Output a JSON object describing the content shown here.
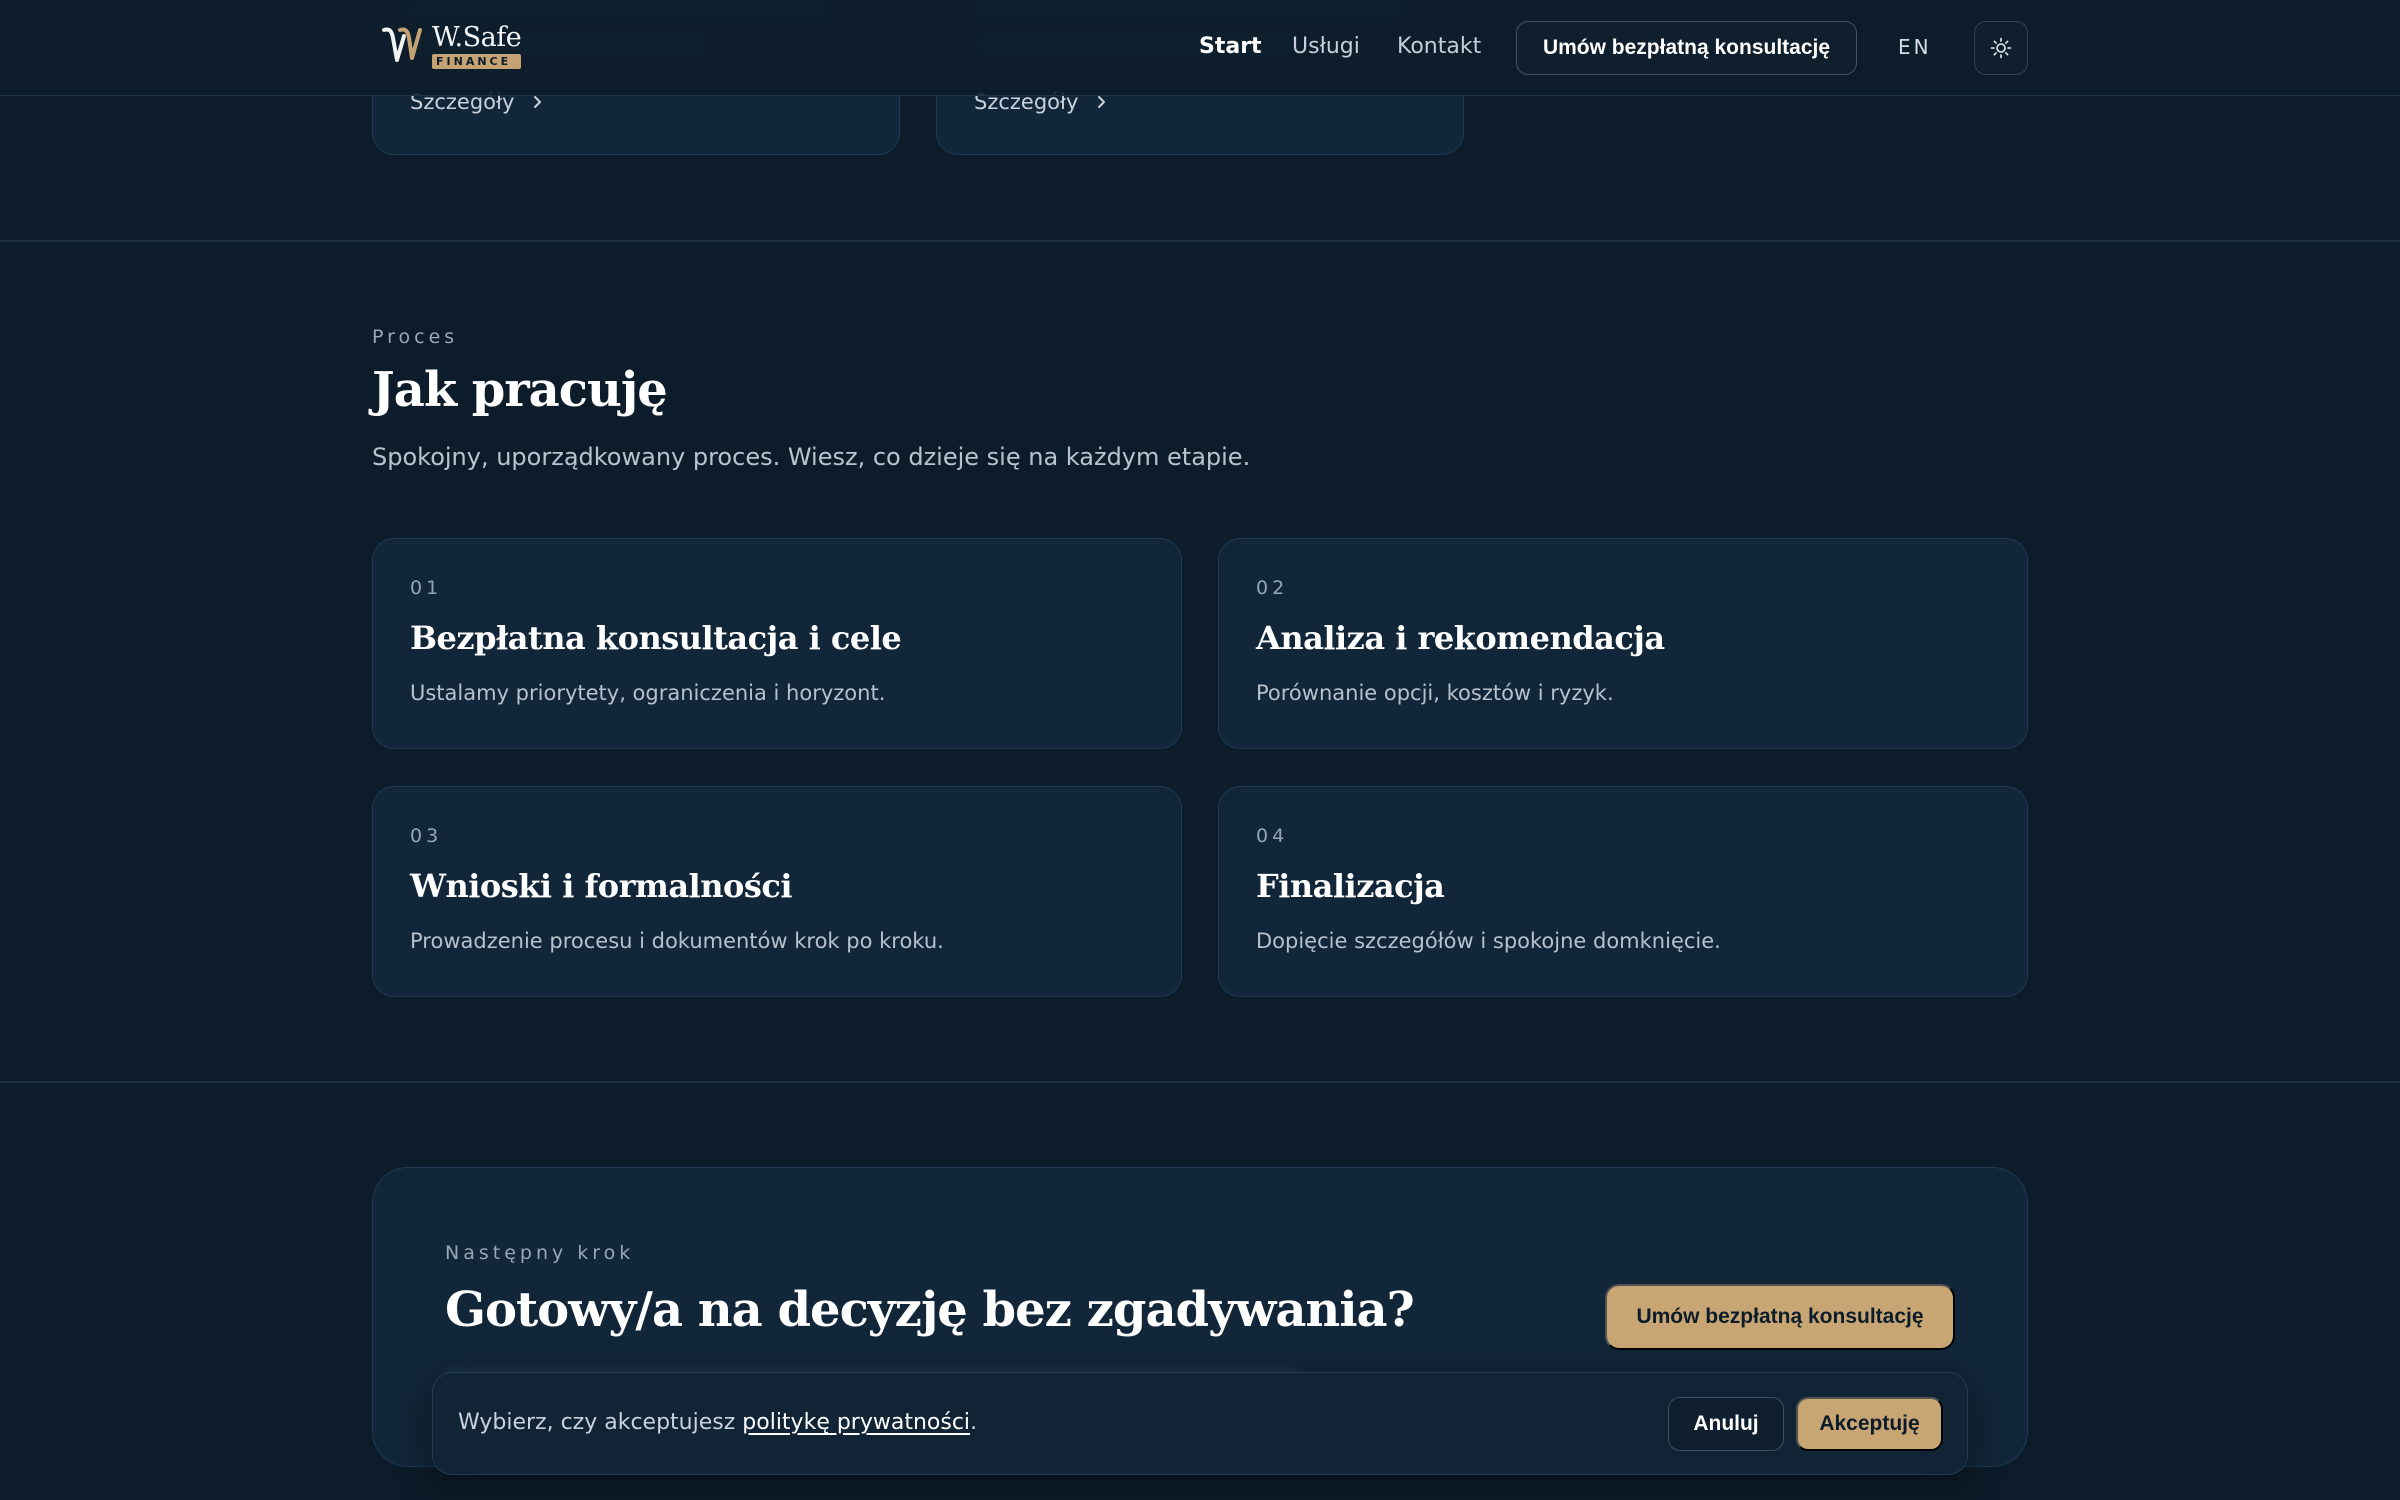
{
  "header": {
    "logo": {
      "name": "W.Safe",
      "sub": "FINANCE"
    },
    "nav": [
      {
        "label": "Start"
      },
      {
        "label": "Usługi"
      },
      {
        "label": "Kontakt"
      }
    ],
    "cta_label": "Umów bezpłatną konsultację",
    "lang_label": "EN",
    "theme_icon": "sun-icon"
  },
  "services": {
    "cards": [
      {
        "link_label": "Szczegóły"
      },
      {
        "link_label": "Szczegóły"
      }
    ]
  },
  "process": {
    "eyebrow": "Proces",
    "title": "Jak pracuję",
    "subtitle": "Spokojny, uporządkowany proces. Wiesz, co dzieje się na każdym etapie.",
    "steps": [
      {
        "num": "01",
        "title": "Bezpłatna konsultacja i cele",
        "desc": "Ustalamy priorytety, ograniczenia i horyzont."
      },
      {
        "num": "02",
        "title": "Analiza i rekomendacja",
        "desc": "Porównanie opcji, kosztów i ryzyk."
      },
      {
        "num": "03",
        "title": "Wnioski i formalności",
        "desc": "Prowadzenie procesu i dokumentów krok po kroku."
      },
      {
        "num": "04",
        "title": "Finalizacja",
        "desc": "Dopięcie szczegółów i spokojne domknięcie."
      }
    ]
  },
  "cta": {
    "eyebrow": "Następny krok",
    "title": "Gotowy/a na decyzję bez zgadywania?",
    "button_label": "Umów bezpłatną konsultację"
  },
  "cookie": {
    "text_before": "Wybierz, czy akceptujesz ",
    "link_label": "politykę prywatności",
    "text_after": ".",
    "cancel_label": "Anuluj",
    "accept_label": "Akceptuję"
  },
  "colors": {
    "background": "#0d1c2a",
    "card": "#112639",
    "accent_gold": "#c8a673"
  }
}
